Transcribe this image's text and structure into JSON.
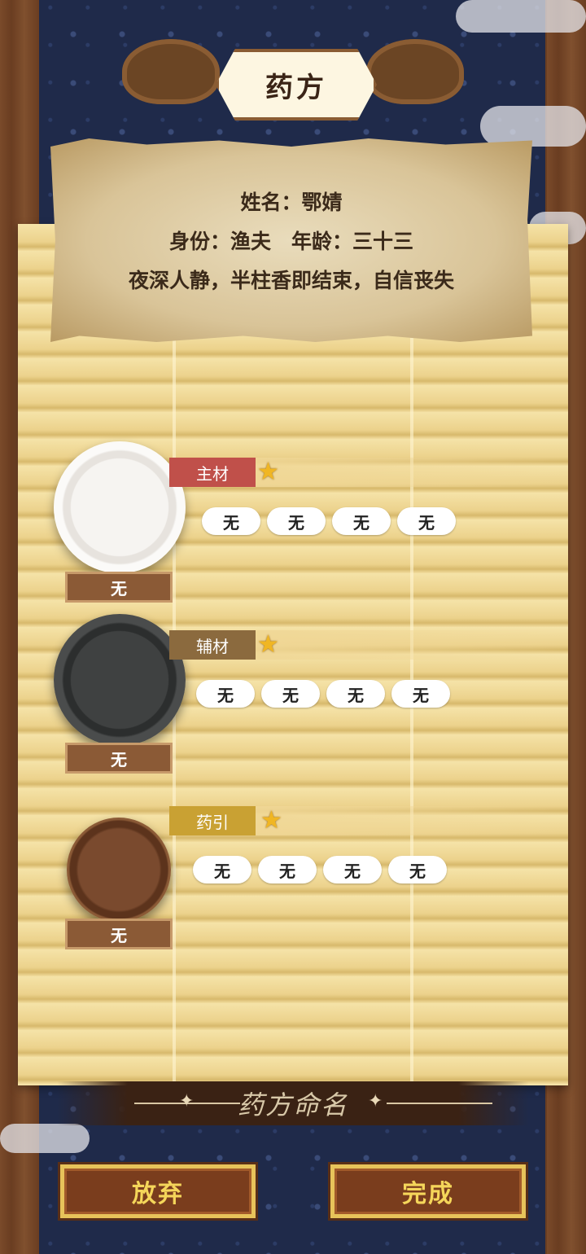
{
  "header": {
    "title": "药方"
  },
  "patient": {
    "name_line": "姓名：鄂婧",
    "identity_line": "身份：渔夫　年龄：三十三",
    "status_line": "夜深人静，半柱香即结束，自信丧失"
  },
  "sections": [
    {
      "category": "主材",
      "category_color": "#c0504a",
      "container_label": "无",
      "slots": [
        "无",
        "无",
        "无",
        "无"
      ]
    },
    {
      "category": "辅材",
      "category_color": "#8b6a3e",
      "container_label": "无",
      "slots": [
        "无",
        "无",
        "无",
        "无"
      ]
    },
    {
      "category": "药引",
      "category_color": "#c9a133",
      "container_label": "无",
      "slots": [
        "无",
        "无",
        "无",
        "无"
      ]
    }
  ],
  "naming": {
    "placeholder": "药方命名"
  },
  "buttons": {
    "abandon": "放弃",
    "complete": "完成"
  },
  "icons": {
    "star": "star-icon"
  }
}
